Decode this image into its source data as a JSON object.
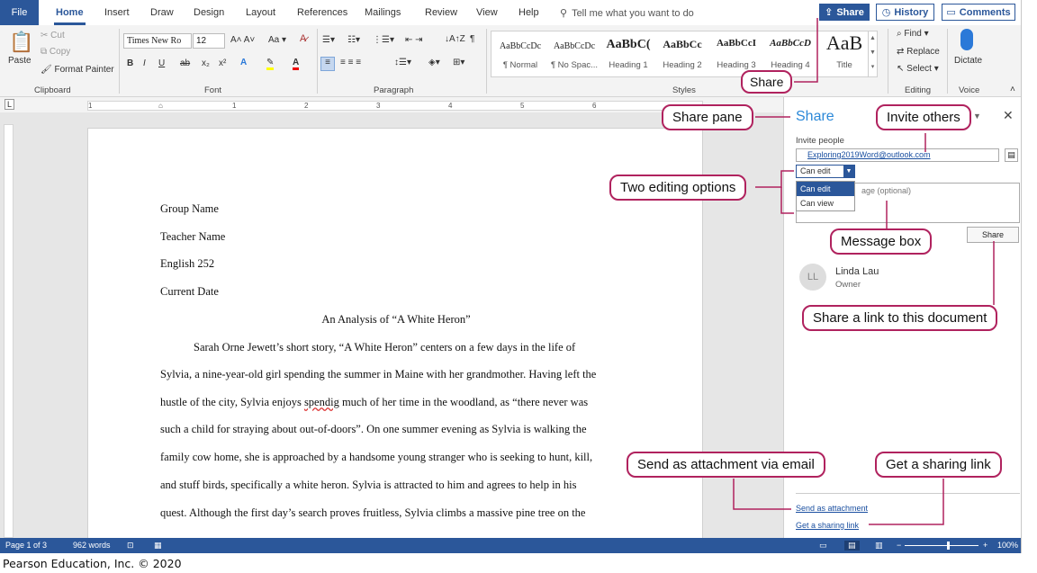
{
  "tabs": {
    "file": "File",
    "items": [
      "Home",
      "Insert",
      "Draw",
      "Design",
      "Layout",
      "References",
      "Mailings",
      "Review",
      "View",
      "Help"
    ],
    "tell_me": "Tell me what you want to do"
  },
  "top_buttons": {
    "share": "Share",
    "history": "History",
    "comments": "Comments"
  },
  "ribbon": {
    "clipboard": {
      "paste": "Paste",
      "cut": "Cut",
      "copy": "Copy",
      "format_painter": "Format Painter",
      "label": "Clipboard"
    },
    "font": {
      "name": "Times New Ro",
      "size": "12",
      "label": "Font"
    },
    "paragraph": {
      "label": "Paragraph"
    },
    "styles": {
      "label": "Styles",
      "items": [
        {
          "sample": "AaBbCcDc",
          "name": "¶ Normal"
        },
        {
          "sample": "AaBbCcDc",
          "name": "¶ No Spac..."
        },
        {
          "sample": "AaBbC(",
          "name": "Heading 1"
        },
        {
          "sample": "AaBbCc",
          "name": "Heading 2"
        },
        {
          "sample": "AaBbCcI",
          "name": "Heading 3"
        },
        {
          "sample": "AaBbCcD",
          "name": "Heading 4"
        },
        {
          "sample": "AaB",
          "name": "Title"
        }
      ]
    },
    "editing": {
      "find": "Find",
      "replace": "Replace",
      "select": "Select",
      "label": "Editing"
    },
    "voice": {
      "dictate": "Dictate",
      "label": "Voice"
    }
  },
  "document": {
    "lines": [
      "Group Name",
      "Teacher Name",
      "English 252",
      "Current Date"
    ],
    "title": "An Analysis of “A White Heron”",
    "body": [
      "Sarah Orne Jewett’s short story, “A White Heron” centers on a few days in the life of",
      "Sylvia, a nine-year-old girl spending the summer in Maine with her grandmother. Having left the",
      "hustle of the city, Sylvia enjoys",
      "much of her time in the woodland, as “there never was",
      "such a child for straying about out-of-doors”. On one summer evening as Sylvia is walking the",
      "family cow home, she is approached by a handsome young stranger who is seeking to hunt, kill,",
      "and stuff birds, specifically a white heron. Sylvia is attracted to him and agrees to help in his",
      "quest. Although the first day’s search proves fruitless, Sylvia climbs a massive pine tree on the"
    ],
    "misspelled_word": "spendig"
  },
  "share_pane": {
    "title": "Share",
    "invite_label": "Invite people",
    "invite_value": "Exploring2019Word@outlook.com",
    "permission_selected": "Can edit",
    "permission_options": [
      "Can edit",
      "Can view"
    ],
    "message_placeholder": "age (optional)",
    "share_button": "Share",
    "owner_initials": "LL",
    "owner_name": "Linda Lau",
    "owner_role": "Owner",
    "send_attachment": "Send as attachment",
    "get_link": "Get a sharing link"
  },
  "status": {
    "page": "Page 1 of 3",
    "words": "962 words",
    "zoom": "100%",
    "zoom_level": 0.58
  },
  "callouts": {
    "share": "Share",
    "share_pane": "Share pane",
    "invite_others": "Invite others",
    "two_editing_options": "Two editing options",
    "message_box": "Message box",
    "share_link": "Share a link to this document",
    "send_attachment_email": "Send as attachment via email",
    "get_sharing_link": "Get a sharing link"
  },
  "copyright": "Pearson Education, Inc. © 2020",
  "colors": {
    "accent": "#2b579a",
    "callout_border": "#b0225e",
    "pane_title": "#2b88d8"
  }
}
